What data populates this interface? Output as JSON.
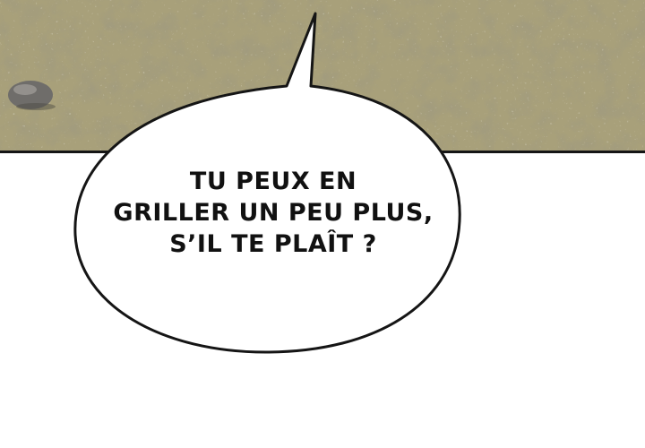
{
  "scene": {
    "ground_color": "#a8a07a",
    "ground_shadow": "#7d7658",
    "ground_light": "#c9c3a2",
    "rock_color": "#6f6d6a",
    "border_color": "#151515",
    "background": "#ffffff"
  },
  "speech_bubble": {
    "lines": [
      "TU PEUX EN",
      "GRILLER UN PEU PLUS,",
      "S’IL TE PLAÎT ?"
    ],
    "fill": "#ffffff",
    "stroke": "#151515"
  }
}
